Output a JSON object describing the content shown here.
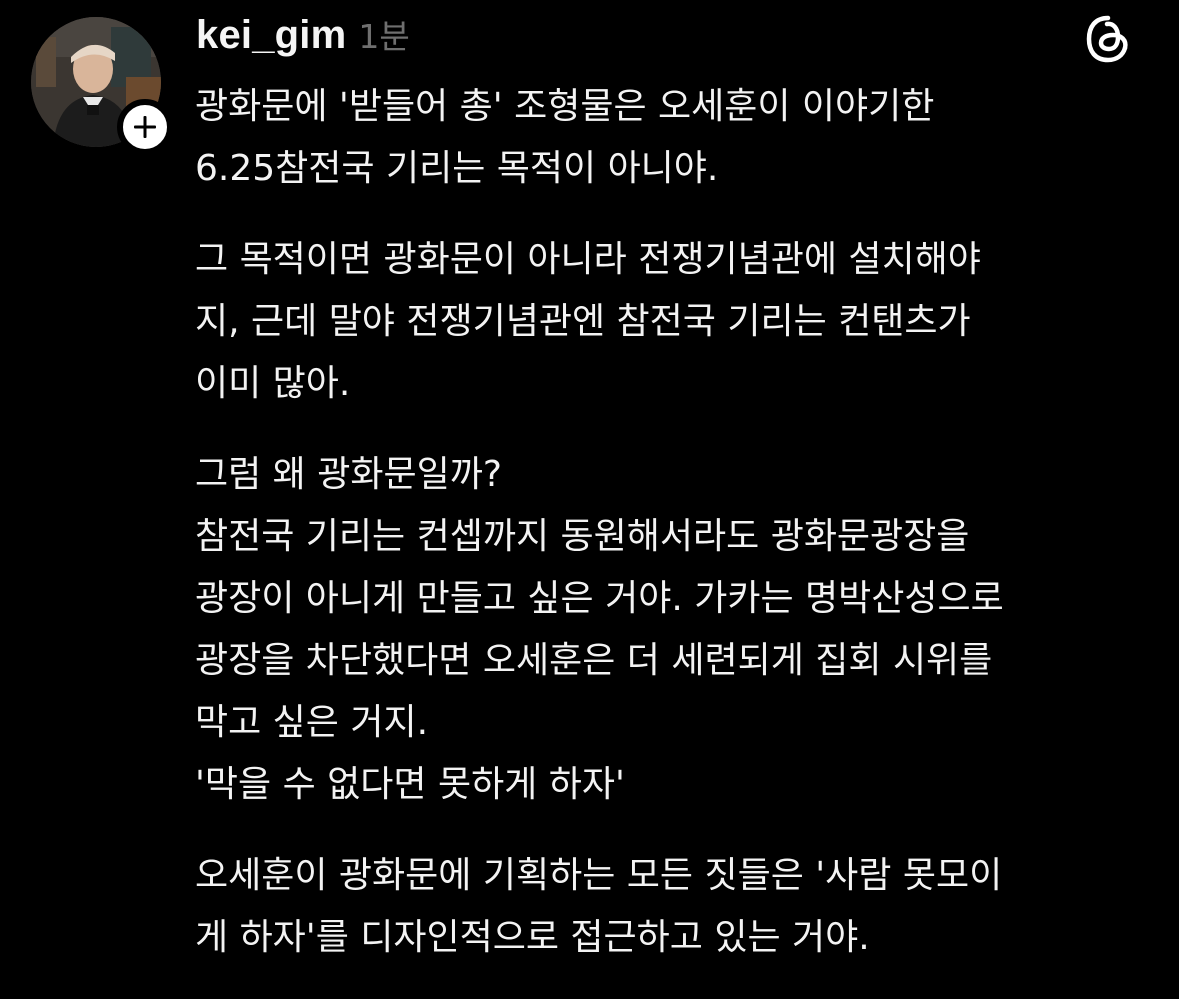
{
  "post": {
    "username": "kei_gim",
    "timestamp": "1분",
    "follow_label": "+",
    "avatar_icon": "user-avatar-photo",
    "logo_icon": "threads-logo-icon",
    "paragraphs": [
      {
        "lines": [
          "광화문에 '받들어 총' 조형물은 오세훈이 이야기한",
          "6.25참전국 기리는 목적이 아니야."
        ]
      },
      {
        "lines": [
          "그 목적이면 광화문이 아니라 전쟁기념관에 설치해야",
          "지, 근데 말야 전쟁기념관엔 참전국 기리는 컨탠츠가",
          "이미 많아."
        ]
      },
      {
        "lines": [
          "그럼 왜 광화문일까?",
          "참전국 기리는 컨셉까지 동원해서라도 광화문광장을",
          "광장이 아니게 만들고 싶은 거야. 가카는 명박산성으로",
          "광장을 차단했다면 오세훈은 더 세련되게 집회 시위를",
          "막고 싶은 거지.",
          "'막을 수 없다면 못하게 하자'"
        ]
      },
      {
        "lines": [
          "오세훈이 광화문에 기획하는 모든 짓들은 '사람 못모이",
          "게 하자'를 디자인적으로 접근하고 있는 거야."
        ]
      }
    ]
  },
  "colors": {
    "background": "#000000",
    "text": "#f3f3f3",
    "muted": "#6f6f6f"
  }
}
